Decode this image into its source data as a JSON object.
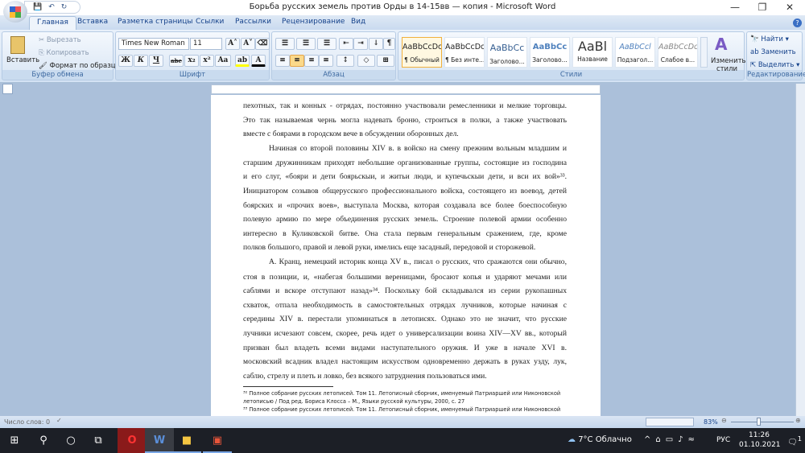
{
  "window": {
    "title": "Борьба русских земель  против Орды в 14-15вв — копия - Microsoft Word"
  },
  "tabs": [
    "Главная",
    "Вставка",
    "Разметка страницы",
    "Ссылки",
    "Рассылки",
    "Рецензирование",
    "Вид"
  ],
  "clipboard": {
    "paste": "Вставить",
    "cut": "Вырезать",
    "copy": "Копировать",
    "format_painter": "Формат по образцу",
    "label": "Буфер обмена"
  },
  "font": {
    "name": "Times New Roman",
    "size": "11",
    "label": "Шрифт",
    "bold": "Ж",
    "italic": "К",
    "underline": "Ч",
    "strike": "abe",
    "sub": "x₂",
    "sup": "x²",
    "case": "Aa",
    "grow": "A˄",
    "shrink": "A˅"
  },
  "paragraph": {
    "label": "Абзац"
  },
  "styles": {
    "label": "Стили",
    "items": [
      {
        "sample": "AaBbCcDc",
        "name": "¶ Обычный"
      },
      {
        "sample": "AaBbCcDc",
        "name": "¶ Без инте..."
      },
      {
        "sample": "AaBbCc",
        "name": "Заголово..."
      },
      {
        "sample": "AaBbCc",
        "name": "Заголово..."
      },
      {
        "sample": "AaBl",
        "name": "Название"
      },
      {
        "sample": "AaBbCcl",
        "name": "Подзагол..."
      },
      {
        "sample": "AaBbCcDc",
        "name": "Слабое в..."
      }
    ],
    "change": "Изменить стили"
  },
  "editing": {
    "find": "Найти",
    "replace": "Заменить",
    "select": "Выделить",
    "label": "Редактирование"
  },
  "document": {
    "lines": [
      "пехотных, так и конных - отрядах, постоянно участвовали ремесленники и мелкие торговцы.",
      "Это так называемая чернь могла надевать броню, строиться в полки, а также участвовать",
      "вместе с боярами в городском вече в обсуждении оборонных дел.",
      "Начиная со второй половины XIV в. в войско на смену прежним вольным младшим и",
      "старшим дружинникам приходят небольшие организованные группы, состоящие из господина",
      "и его слуг, «бояри и дети боярьскыи, и житьи люди, и купечьскыи дети, и вси их вой»³³.",
      "Инициатором созывов общерусского профессионального войска, состоящего из воевод, детей",
      "боярских и «прочих воев», выступала Москва, которая создавала все более боеспособную",
      "полевую армию по мере объединения русских земель. Строение полевой армии особенно",
      "интересно в Куликовской битве. Она стала первым генеральным сражением, где, кроме",
      "полков большого, правой и левой руки, имелись еще засадный, передовой и сторожевой.",
      "А. Кранц, немецкий историк конца XV в., писал о русских, что сражаются они обычно,",
      "стоя в позиции, и, «набегая большими вереницами, бросают копья и ударяют мечами или",
      "саблями и вскоре отступают назад»³⁴. Поскольку бой складывался из серии рукопашных",
      "схваток, отпала необходимость в самостоятельных отрядах лучников, которые начиная с",
      "середины XIV в. перестали упоминаться в летописях. Однако это не значит, что русские",
      "лучники исчезают совсем, скорее, речь идет о универсализации воина XIV—XV вв., который",
      "призван был владеть всеми видами наступательного оружия. И уже в начале XVI в.",
      "московский всадник владел настоящим искусством одновременно держать в руках узду, лук,",
      "саблю, стрелу и плеть и ловко, без всякого затруднения пользоваться ими."
    ],
    "footnotes": [
      "³² Полное собрание русских летописей. Том 11. Летописный сборник, именуемый Патриаршей или Никоновской",
      "летописью / Под ред. Бориса Клосса – М., Языки русской культуры, 2000, с. 27",
      "³³ Полное собрание русских летописей. Том 11. Летописный сборник, именуемый Патриаршей или Никоновской"
    ]
  },
  "status": {
    "words": "Число слов: 0",
    "zoom": "83%"
  },
  "taskbar": {
    "weather": "7°C  Облачно",
    "lang": "РУС",
    "time": "11:26",
    "date": "01.10.2021",
    "notif": "1"
  }
}
